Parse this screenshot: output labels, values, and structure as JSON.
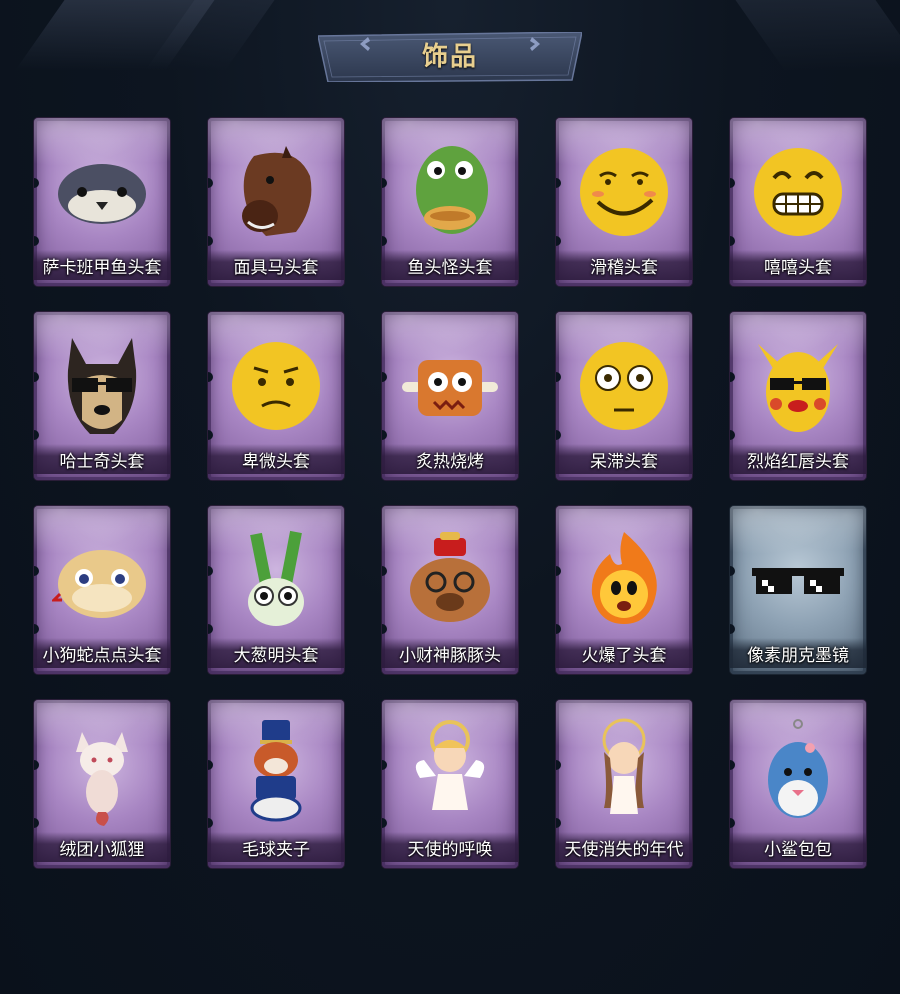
{
  "header": {
    "title": "饰品"
  },
  "colors": {
    "background": "#0c1420",
    "title": "#e8cf8f",
    "card_purple": "#a886c3",
    "card_blue": "#8ea2b4"
  },
  "items": [
    {
      "name": "萨卡班甲鱼头套",
      "icon": "fish-head-icon",
      "frame": "purple"
    },
    {
      "name": "面具马头套",
      "icon": "horse-head-icon",
      "frame": "purple"
    },
    {
      "name": "鱼头怪头套",
      "icon": "fish-monster-icon",
      "frame": "purple"
    },
    {
      "name": "滑稽头套",
      "icon": "smirk-face-icon",
      "frame": "purple"
    },
    {
      "name": "嘻嘻头套",
      "icon": "grin-face-icon",
      "frame": "purple"
    },
    {
      "name": "哈士奇头套",
      "icon": "husky-sunglasses-icon",
      "frame": "purple"
    },
    {
      "name": "卑微头套",
      "icon": "humble-face-icon",
      "frame": "purple"
    },
    {
      "name": "炙热烧烤",
      "icon": "bbq-meat-icon",
      "frame": "purple"
    },
    {
      "name": "呆滞头套",
      "icon": "dazed-face-icon",
      "frame": "purple"
    },
    {
      "name": "烈焰红唇头套",
      "icon": "pikachu-sunglasses-icon",
      "frame": "purple"
    },
    {
      "name": "小狗蛇点点头套",
      "icon": "snake-head-icon",
      "frame": "purple"
    },
    {
      "name": "大葱明头套",
      "icon": "scallion-icon",
      "frame": "purple"
    },
    {
      "name": "小财神豚豚头",
      "icon": "capybara-icon",
      "frame": "purple"
    },
    {
      "name": "火爆了头套",
      "icon": "fire-spirit-icon",
      "frame": "purple"
    },
    {
      "name": "像素朋克墨镜",
      "icon": "pixel-sunglasses-icon",
      "frame": "blue"
    },
    {
      "name": "绒团小狐狸",
      "icon": "fox-plush-icon",
      "frame": "purple"
    },
    {
      "name": "毛球夹子",
      "icon": "red-panda-drummer-icon",
      "frame": "purple"
    },
    {
      "name": "天使的呼唤",
      "icon": "angel-doll-icon",
      "frame": "purple"
    },
    {
      "name": "天使消失的年代",
      "icon": "angel-girl-doll-icon",
      "frame": "purple"
    },
    {
      "name": "小鲨包包",
      "icon": "shark-bag-icon",
      "frame": "purple"
    }
  ]
}
